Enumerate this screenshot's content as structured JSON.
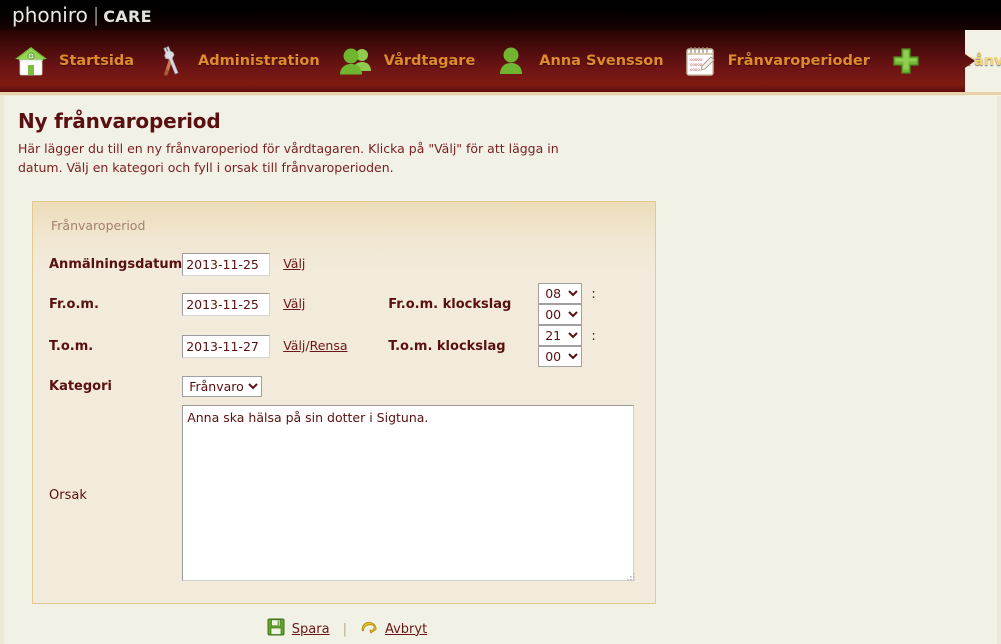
{
  "header": {
    "logo_main": "phoniro",
    "logo_separator": "|",
    "logo_sub": "CARE"
  },
  "nav": {
    "items": [
      {
        "label": "Startsida",
        "icon": "home-icon",
        "active": false
      },
      {
        "label": "Administration",
        "icon": "tools-icon",
        "active": false
      },
      {
        "label": "Vårdtagare",
        "icon": "users-icon",
        "active": false
      },
      {
        "label": "Anna Svensson",
        "icon": "user-icon",
        "active": false
      },
      {
        "label": "Frånvaroperioder",
        "icon": "calendar-icon",
        "active": false
      },
      {
        "label": "Ny frånvaroperiod",
        "icon": "plus-icon",
        "active": true
      }
    ]
  },
  "page": {
    "title": "Ny frånvaroperiod",
    "description": "Här lägger du till en ny frånvaroperiod för vårdtagaren. Klicka på \"Välj\" för att lägga in datum. Välj en kategori och fyll i orsak till frånvaroperioden."
  },
  "form": {
    "legend": "Frånvaroperiod",
    "anmalningsdatum": {
      "label": "Anmälningsdatum",
      "value": "2013-11-25",
      "choose_link": "Välj"
    },
    "from": {
      "label": "Fr.o.m.",
      "value": "2013-11-25",
      "choose_link": "Välj"
    },
    "tom": {
      "label": "T.o.m.",
      "value": "2013-11-27",
      "choose_link": "Välj",
      "separator": "/",
      "clear_link": "Rensa"
    },
    "from_time": {
      "label": "Fr.o.m. klockslag",
      "hour": "08",
      "colon": ":",
      "minute": "00"
    },
    "tom_time": {
      "label": "T.o.m. klockslag",
      "hour": "21",
      "colon": ":",
      "minute": "00"
    },
    "kategori": {
      "label": "Kategori",
      "value": "Frånvaro",
      "options": [
        "Frånvaro"
      ]
    },
    "orsak": {
      "label": "Orsak",
      "value": "Anna ska hälsa på sin dotter i Sigtuna.",
      "placeholder": ""
    }
  },
  "actions": {
    "save_label": "Spara",
    "save_icon": "save-floppy-icon",
    "divider": "|",
    "cancel_label": "Avbryt",
    "cancel_icon": "undo-arrow-icon"
  },
  "colors": {
    "nav_gradient_top": "#270404",
    "nav_gradient_mid": "#6d1414",
    "nav_label": "#e08a2e",
    "nav_label_active": "#f4d678",
    "page_background": "#f1f1e6",
    "panel_background": "#f2eada",
    "panel_border": "#e2c98f",
    "text_dark_red": "#5a1010",
    "link": "#6b1616",
    "gold_rule": "#e8d2a4",
    "icon_green": "#5fa22a"
  }
}
